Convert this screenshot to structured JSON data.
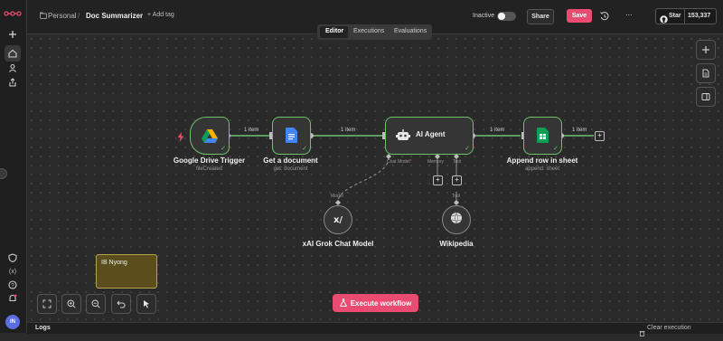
{
  "header": {
    "project": "Personal",
    "separator": "/",
    "workflow_name": "Doc Summarizer",
    "add_tag": "+ Add tag",
    "status_label": "Inactive",
    "share_label": "Share",
    "save_label": "Save",
    "more_label": "...",
    "github_star_label": "Star",
    "github_star_count": "153,337"
  },
  "tabs": [
    {
      "label": "Editor",
      "active": true
    },
    {
      "label": "Executions",
      "active": false
    },
    {
      "label": "Evaluations",
      "active": false
    }
  ],
  "nodes": {
    "trigger": {
      "title": "Google Drive Trigger",
      "subtitle": "fileCreated"
    },
    "get_document": {
      "title": "Get a document",
      "subtitle": "get: document"
    },
    "agent": {
      "title": "AI Agent",
      "port_chat_model": "Chat Model",
      "port_chat_model_required": "*",
      "port_memory": "Memory",
      "port_tool": "Tool"
    },
    "append_row": {
      "title": "Append row in sheet",
      "subtitle": "append: sheet"
    },
    "chat_model": {
      "title": "xAI Grok Chat Model",
      "port_label": "Model"
    },
    "wikipedia": {
      "title": "Wikipedia",
      "port_label": "Tool"
    }
  },
  "edges": {
    "e1": "1 item",
    "e2": "1 item",
    "e3": "1 item",
    "e4": "1 item"
  },
  "sticky_note": {
    "text": "IB Nyong"
  },
  "execute_button": {
    "label": "Execute workflow"
  },
  "logs": {
    "title": "Logs",
    "clear_label": "Clear execution"
  },
  "user": {
    "initials": "IN"
  },
  "colors": {
    "accent": "#ea4b71",
    "success": "#6ec26e",
    "sticky_bg": "#5a4f1c",
    "sticky_border": "#b8a24a"
  },
  "icons": {
    "rail": [
      "n8n-logo-icon",
      "plus-icon",
      "home-icon",
      "user-icon",
      "share-icon",
      "shield-icon",
      "variables-icon",
      "help-icon",
      "bell-icon"
    ],
    "right_panel": [
      "plus-icon",
      "document-icon",
      "sidebar-icon"
    ],
    "zoom": [
      "fit-view-icon",
      "zoom-in-icon",
      "zoom-out-icon",
      "undo-icon",
      "pointer-icon"
    ]
  }
}
